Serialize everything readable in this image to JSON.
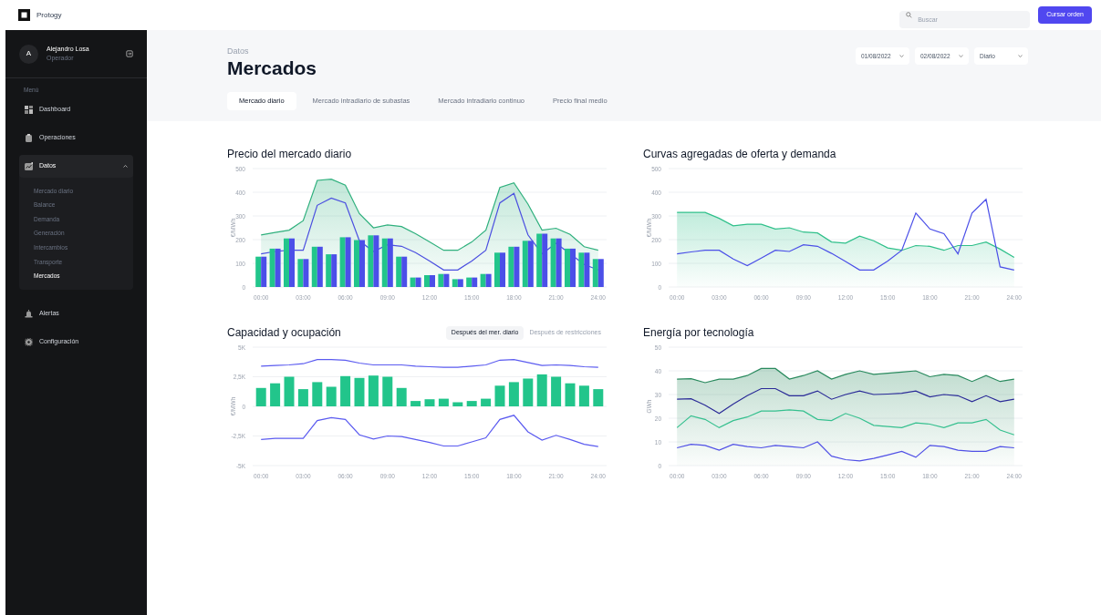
{
  "topbar": {
    "brand": "Protogy",
    "search": {
      "placeholder": "Buscar"
    },
    "button": "Cursar orden"
  },
  "sidebar": {
    "user": {
      "initial": "A",
      "name": "Alejandro Losa",
      "role": "Operador"
    },
    "menu_label": "Menú",
    "items": [
      {
        "label": "Dashboard"
      },
      {
        "label": "Operaciones"
      },
      {
        "label": "Datos",
        "expanded": true,
        "children": [
          {
            "label": "Mercado diario",
            "selected": false
          },
          {
            "label": "Balance",
            "selected": false
          },
          {
            "label": "Demanda",
            "selected": false
          },
          {
            "label": "Generación",
            "selected": false
          },
          {
            "label": "Intercambios",
            "selected": false
          },
          {
            "label": "Transporte",
            "selected": false
          },
          {
            "label": "Mercados",
            "selected": true
          }
        ]
      },
      {
        "label": "Alertas"
      },
      {
        "label": "Configuración"
      }
    ]
  },
  "header": {
    "breadcrumb": "Datos",
    "title": "Mercados",
    "filters": [
      "01/08/2022",
      "02/08/2022",
      "Diario"
    ]
  },
  "tabs": [
    {
      "label": "Mercado diario",
      "selected": true
    },
    {
      "label": "Mercado intradiario de subastas",
      "selected": false
    },
    {
      "label": "Mercado intradiario continuo",
      "selected": false
    },
    {
      "label": "Precio final medio",
      "selected": false
    }
  ],
  "charts": [
    {
      "title": "Precio del mercado diario",
      "chart_data": {
        "type": "bar",
        "ylabel": "€/MWh",
        "grid": true,
        "x": [
          0,
          1,
          2,
          3,
          4,
          5,
          6,
          7,
          8,
          9,
          10,
          11,
          12,
          13,
          14,
          15,
          16,
          17,
          18,
          19,
          20,
          21,
          22,
          23,
          24
        ],
        "xlim": [
          -0.6,
          24.6
        ],
        "ylim": [
          0,
          500
        ],
        "yticks": [
          0,
          100,
          200,
          300,
          400,
          500
        ],
        "xticks": [
          {
            "value": 0,
            "label": "00:00"
          },
          {
            "value": 3,
            "label": "03:00"
          },
          {
            "value": 6,
            "label": "06:00"
          },
          {
            "value": 9,
            "label": "09:00"
          },
          {
            "value": 12,
            "label": "12:00"
          },
          {
            "value": 15,
            "label": "15:00"
          },
          {
            "value": 18,
            "label": "18:00"
          },
          {
            "value": 21,
            "label": "21:00"
          },
          {
            "value": 24,
            "label": "24:00"
          }
        ],
        "series": [
          {
            "type": "area",
            "color": "#2fb07d",
            "values": [
              220,
              230,
              240,
              280,
              450,
              455,
              430,
              310,
              250,
              262,
              255,
              225,
              190,
              155,
              155,
              190,
              240,
              420,
              440,
              350,
              240,
              248,
              222,
              170,
              155
            ]
          },
          {
            "type": "line",
            "color": "#4b4fe0",
            "values": [
              140,
              150,
              155,
              155,
              345,
              375,
              355,
              195,
              150,
              178,
              172,
              145,
              110,
              72,
              72,
              110,
              155,
              355,
              395,
              220,
              140,
              185,
              140,
              95,
              72
            ]
          },
          {
            "color": "#22c58b",
            "values": [
              128,
              162,
              205,
              118,
              170,
              138,
              210,
              198,
              218,
              205,
              128,
              40,
              50,
              55,
              33,
              40,
              55,
              145,
              170,
              195,
              225,
              205,
              162,
              145,
              118
            ]
          },
          {
            "color": "#4b4fe8",
            "values": [
              128,
              162,
              205,
              118,
              170,
              138,
              210,
              198,
              218,
              205,
              128,
              40,
              50,
              55,
              33,
              40,
              55,
              145,
              170,
              195,
              225,
              205,
              162,
              145,
              118
            ]
          }
        ]
      }
    },
    {
      "title": "Curvas agregadas de oferta y demanda",
      "chart_data": {
        "type": "area",
        "ylabel": "€/MWh",
        "grid": true,
        "x": [
          0,
          1,
          2,
          3,
          4,
          5,
          6,
          7,
          8,
          9,
          10,
          11,
          12,
          13,
          14,
          15,
          16,
          17,
          18,
          19,
          20,
          21,
          22,
          23,
          24
        ],
        "xlim": [
          -0.6,
          24.6
        ],
        "ylim": [
          0,
          500
        ],
        "yticks": [
          0,
          100,
          200,
          300,
          400,
          500
        ],
        "xticks": [
          {
            "value": 0,
            "label": "00:00"
          },
          {
            "value": 3,
            "label": "03:00"
          },
          {
            "value": 6,
            "label": "06:00"
          },
          {
            "value": 9,
            "label": "09:00"
          },
          {
            "value": 12,
            "label": "12:00"
          },
          {
            "value": 15,
            "label": "15:00"
          },
          {
            "value": 18,
            "label": "18:00"
          },
          {
            "value": 21,
            "label": "21:00"
          },
          {
            "value": 24,
            "label": "24:00"
          }
        ],
        "series": [
          {
            "color": "#2fc08a",
            "values": [
              315,
              315,
              315,
              290,
              258,
              265,
              265,
              245,
              250,
              232,
              228,
              190,
              185,
              215,
              195,
              165,
              155,
              175,
              172,
              155,
              175,
              175,
              190,
              160,
              125
            ]
          },
          {
            "type": "line",
            "color": "#4b4fe8",
            "values": [
              140,
              148,
              155,
              155,
              118,
              90,
              122,
              155,
              150,
              178,
              172,
              142,
              108,
              72,
              72,
              110,
              155,
              312,
              245,
              225,
              140,
              312,
              370,
              85,
              72
            ]
          }
        ]
      }
    },
    {
      "title": "Capacidad y ocupación",
      "toggles": [
        {
          "label": "Después del mer. diario",
          "selected": true
        },
        {
          "label": "Después de restricciones",
          "selected": false
        }
      ],
      "chart_data": {
        "type": "bar",
        "ylabel": "€/MWh",
        "grid": true,
        "x": [
          0,
          1,
          2,
          3,
          4,
          5,
          6,
          7,
          8,
          9,
          10,
          11,
          12,
          13,
          14,
          15,
          16,
          17,
          18,
          19,
          20,
          21,
          22,
          23,
          24
        ],
        "xlim": [
          -0.6,
          24.6
        ],
        "ylim": [
          -5000,
          5000
        ],
        "yticks": [
          {
            "value": 5000,
            "label": "5K"
          },
          {
            "value": 2500,
            "label": "2,5K"
          },
          {
            "value": 0,
            "label": "0"
          },
          {
            "value": -2500,
            "label": "-2,5K"
          },
          {
            "value": -5000,
            "label": "-5K"
          }
        ],
        "xticks": [
          {
            "value": 0,
            "label": "00:00"
          },
          {
            "value": 3,
            "label": "03:00"
          },
          {
            "value": 6,
            "label": "06:00"
          },
          {
            "value": 9,
            "label": "09:00"
          },
          {
            "value": 12,
            "label": "12:00"
          },
          {
            "value": 15,
            "label": "15:00"
          },
          {
            "value": 18,
            "label": "18:00"
          },
          {
            "value": 21,
            "label": "21:00"
          },
          {
            "value": 24,
            "label": "24:00"
          }
        ],
        "series": [
          {
            "color": "#22c58b",
            "values": [
              1550,
              1950,
              2500,
              1450,
              2050,
              1650,
              2550,
              2400,
              2600,
              2500,
              1550,
              450,
              600,
              650,
              350,
              450,
              650,
              1750,
              2050,
              2350,
              2700,
              2500,
              1950,
              1750,
              1450
            ]
          },
          {
            "type": "line",
            "color": "#5b5bf0",
            "values": [
              3400,
              3450,
              3500,
              3600,
              3950,
              3950,
              3900,
              3650,
              3500,
              3500,
              3500,
              3400,
              3350,
              3300,
              3300,
              3400,
              3500,
              3900,
              3950,
              3700,
              3450,
              3500,
              3450,
              3350,
              3300
            ]
          },
          {
            "type": "line",
            "color": "#5b5bf0",
            "values": [
              -2800,
              -2700,
              -2700,
              -2700,
              -1200,
              -950,
              -1100,
              -2400,
              -2750,
              -2500,
              -2550,
              -2800,
              -3050,
              -3350,
              -3350,
              -3000,
              -2650,
              -1100,
              -750,
              -2150,
              -2850,
              -2450,
              -2800,
              -3200,
              -3400
            ]
          }
        ]
      }
    },
    {
      "title": "Energía por tecnología",
      "chart_data": {
        "type": "area",
        "ylabel": "GWh",
        "grid": true,
        "x": [
          0,
          1,
          2,
          3,
          4,
          5,
          6,
          7,
          8,
          9,
          10,
          11,
          12,
          13,
          14,
          15,
          16,
          17,
          18,
          19,
          20,
          21,
          22,
          23,
          24
        ],
        "xlim": [
          -0.6,
          24.6
        ],
        "ylim": [
          0,
          50
        ],
        "yticks": [
          0,
          10,
          20,
          30,
          40,
          50
        ],
        "xticks": [
          {
            "value": 0,
            "label": "00:00"
          },
          {
            "value": 3,
            "label": "03:00"
          },
          {
            "value": 6,
            "label": "06:00"
          },
          {
            "value": 9,
            "label": "09:00"
          },
          {
            "value": 12,
            "label": "12:00"
          },
          {
            "value": 15,
            "label": "15:00"
          },
          {
            "value": 18,
            "label": "18:00"
          },
          {
            "value": 21,
            "label": "21:00"
          },
          {
            "value": 24,
            "label": "24:00"
          }
        ],
        "series": [
          {
            "color": "#2a8a5e",
            "values": [
              36.5,
              36.7,
              35,
              36.5,
              36.5,
              38,
              41,
              41,
              36.5,
              38,
              40,
              36.5,
              38.5,
              40,
              38.5,
              39,
              39.5,
              40,
              37.5,
              38.5,
              38,
              35.5,
              38,
              35.5,
              36.5
            ]
          },
          {
            "type": "line",
            "color": "#2b2b98",
            "values": [
              28,
              28.2,
              25.5,
              22,
              26,
              29.5,
              32.5,
              32.5,
              29.5,
              29.5,
              31.5,
              28,
              30,
              31.5,
              30,
              30.2,
              30.5,
              31.5,
              29,
              30,
              29.5,
              27,
              29.5,
              27,
              28
            ]
          },
          {
            "type": "line",
            "color": "#36c08f",
            "values": [
              16,
              21,
              19.5,
              16,
              19,
              20.5,
              23,
              23,
              23.5,
              23,
              19.5,
              19,
              22,
              20,
              17,
              16.5,
              16,
              18,
              17.5,
              16,
              18,
              18,
              19.5,
              15,
              13
            ]
          },
          {
            "type": "line",
            "color": "#5050e6",
            "values": [
              7.5,
              9,
              8.5,
              6.5,
              9,
              8,
              7.5,
              8.5,
              8,
              7.5,
              10,
              4,
              2.5,
              2,
              3,
              4.5,
              6,
              3.5,
              8.5,
              8,
              6.5,
              6,
              6,
              8,
              7.5
            ]
          }
        ]
      }
    }
  ]
}
